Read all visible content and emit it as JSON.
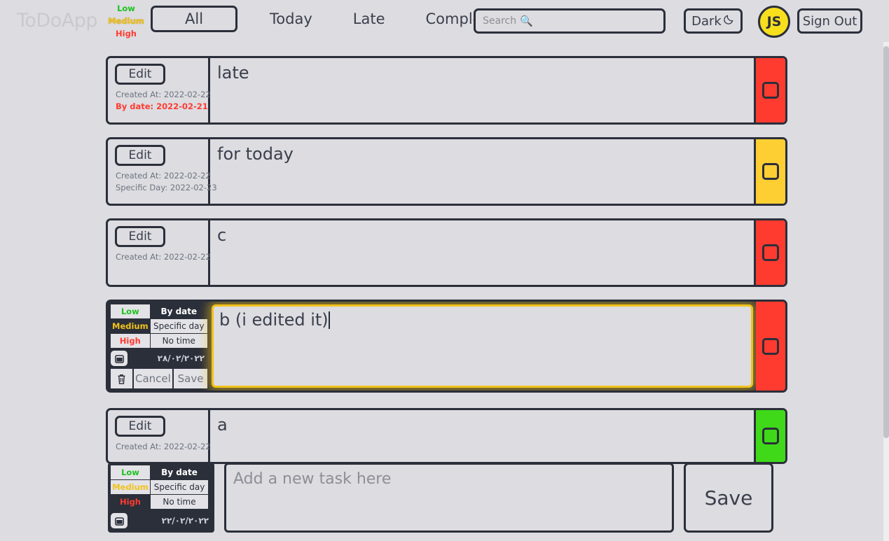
{
  "header": {
    "brand": "ToDoApp",
    "legend": {
      "low": "Low",
      "medium": "Medium",
      "high": "High"
    },
    "tabs": [
      {
        "label": "All",
        "active": true
      },
      {
        "label": "Today",
        "active": false
      },
      {
        "label": "Late",
        "active": false
      },
      {
        "label": "Complete",
        "active": false
      }
    ],
    "search": {
      "placeholder": "Search",
      "value": "",
      "icon": "magnifier-icon"
    },
    "dark_button": {
      "label": "Dark",
      "icon": "moon-icon"
    },
    "avatar": {
      "initials": "JS",
      "color": "#f7df1e"
    },
    "signout_label": "Sign Out"
  },
  "tasks": [
    {
      "edit_label": "Edit",
      "text": "late",
      "created": "Created At: 2022-02-22",
      "due": "By date: 2022-02-21",
      "due_overdue": true,
      "priority_color": "#ff3b30",
      "checked": false
    },
    {
      "edit_label": "Edit",
      "text": "for today",
      "created": "Created At: 2022-02-22",
      "due": "Specific Day: 2022-02-23",
      "due_overdue": false,
      "priority_color": "#fdcf33",
      "checked": false
    },
    {
      "edit_label": "Edit",
      "text": "c",
      "created": "Created At: 2022-02-22",
      "due": "",
      "due_overdue": false,
      "priority_color": "#ff3b30",
      "checked": false
    }
  ],
  "editing_task": {
    "text": "b (i edited it)",
    "priority_options": [
      {
        "label": "Low",
        "selected": false
      },
      {
        "label": "Medium",
        "selected": true
      },
      {
        "label": "High",
        "selected": false
      }
    ],
    "time_options": [
      {
        "label": "By date",
        "selected": true
      },
      {
        "label": "Specific day",
        "selected": false
      },
      {
        "label": "No time",
        "selected": false
      }
    ],
    "date_value": "۲۸/۰۲/۲۰۲۲",
    "calendar_icon": "calendar-icon",
    "delete_icon": "trash-icon",
    "cancel_label": "Cancel",
    "save_label": "Save",
    "priority_color": "#ff3b30",
    "checked": false
  },
  "task_last": {
    "edit_label": "Edit",
    "text": "a",
    "created": "Created At: 2022-02-22",
    "due": "",
    "priority_color": "#3fd919",
    "checked": false
  },
  "add_form": {
    "priority_options": [
      {
        "label": "Low",
        "selected": false
      },
      {
        "label": "Medium",
        "selected": false
      },
      {
        "label": "High",
        "selected": true
      }
    ],
    "time_options": [
      {
        "label": "By date",
        "selected": true
      },
      {
        "label": "Specific day",
        "selected": false
      },
      {
        "label": "No time",
        "selected": false
      }
    ],
    "date_value": "۲۲/۰۲/۲۰۲۲",
    "calendar_icon": "calendar-icon",
    "input_placeholder": "Add a new task here",
    "input_value": "",
    "save_label": "Save"
  }
}
